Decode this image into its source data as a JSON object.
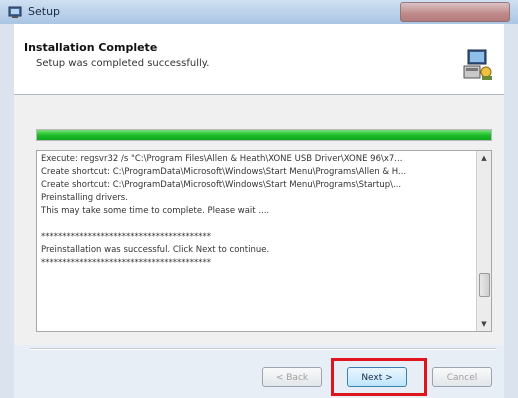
{
  "window": {
    "title": "Setup"
  },
  "header": {
    "title": "Installation Complete",
    "subtitle": "Setup was completed successfully."
  },
  "progress": {
    "value": 1.0
  },
  "log": {
    "lines": [
      "Execute: regsvr32 /s \"C:\\Program Files\\Allen & Heath\\XONE USB Driver\\XONE 96\\x7...",
      "Create shortcut: C:\\ProgramData\\Microsoft\\Windows\\Start Menu\\Programs\\Allen & H...",
      "Create shortcut: C:\\ProgramData\\Microsoft\\Windows\\Start Menu\\Programs\\Startup\\...",
      "Preinstalling drivers.",
      "This may take some time to complete. Please wait ....",
      "",
      "****************************************",
      "Preinstallation was successful. Click Next to continue.",
      "****************************************"
    ]
  },
  "buttons": {
    "back": "< Back",
    "next": "Next >",
    "cancel": "Cancel"
  },
  "colors": {
    "progress": "#1dbf2a",
    "highlight": "#e0141c"
  },
  "icons": {
    "app": "setup-icon",
    "header": "computer-install-icon"
  }
}
